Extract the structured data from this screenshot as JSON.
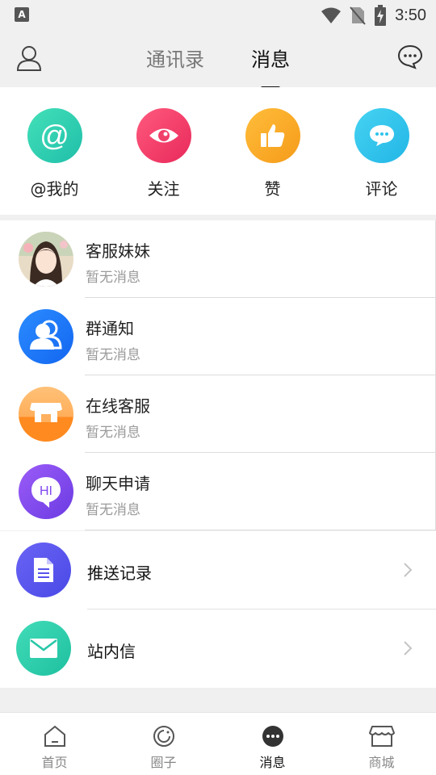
{
  "status_bar": {
    "app_badge": "A",
    "time": "3:50"
  },
  "header": {
    "tabs": [
      {
        "label": "通讯录",
        "active": false
      },
      {
        "label": "消息",
        "active": true
      }
    ]
  },
  "quick_actions": [
    {
      "label": "@我的",
      "icon": "at-icon",
      "color": "#2ccfb3"
    },
    {
      "label": "关注",
      "icon": "eye-icon",
      "color": "#f2416b"
    },
    {
      "label": "赞",
      "icon": "thumbs-up-icon",
      "color": "#f8a423"
    },
    {
      "label": "评论",
      "icon": "comment-icon",
      "color": "#2ec4ec"
    }
  ],
  "conversations": [
    {
      "title": "客服妹妹",
      "subtitle": "暂无消息",
      "avatar": "user-photo"
    },
    {
      "title": "群通知",
      "subtitle": "暂无消息",
      "avatar": "group-icon"
    },
    {
      "title": "在线客服",
      "subtitle": "暂无消息",
      "avatar": "shop-icon"
    },
    {
      "title": "聊天申请",
      "subtitle": "暂无消息",
      "avatar": "hi-chat-icon"
    }
  ],
  "other_items": [
    {
      "title": "推送记录",
      "icon": "document-icon"
    },
    {
      "title": "站内信",
      "icon": "mail-icon"
    }
  ],
  "bottom_nav": [
    {
      "label": "首页",
      "icon": "home-icon",
      "active": false
    },
    {
      "label": "圈子",
      "icon": "circle-icon",
      "active": false
    },
    {
      "label": "消息",
      "icon": "message-icon",
      "active": true
    },
    {
      "label": "商城",
      "icon": "store-icon",
      "active": false
    }
  ]
}
